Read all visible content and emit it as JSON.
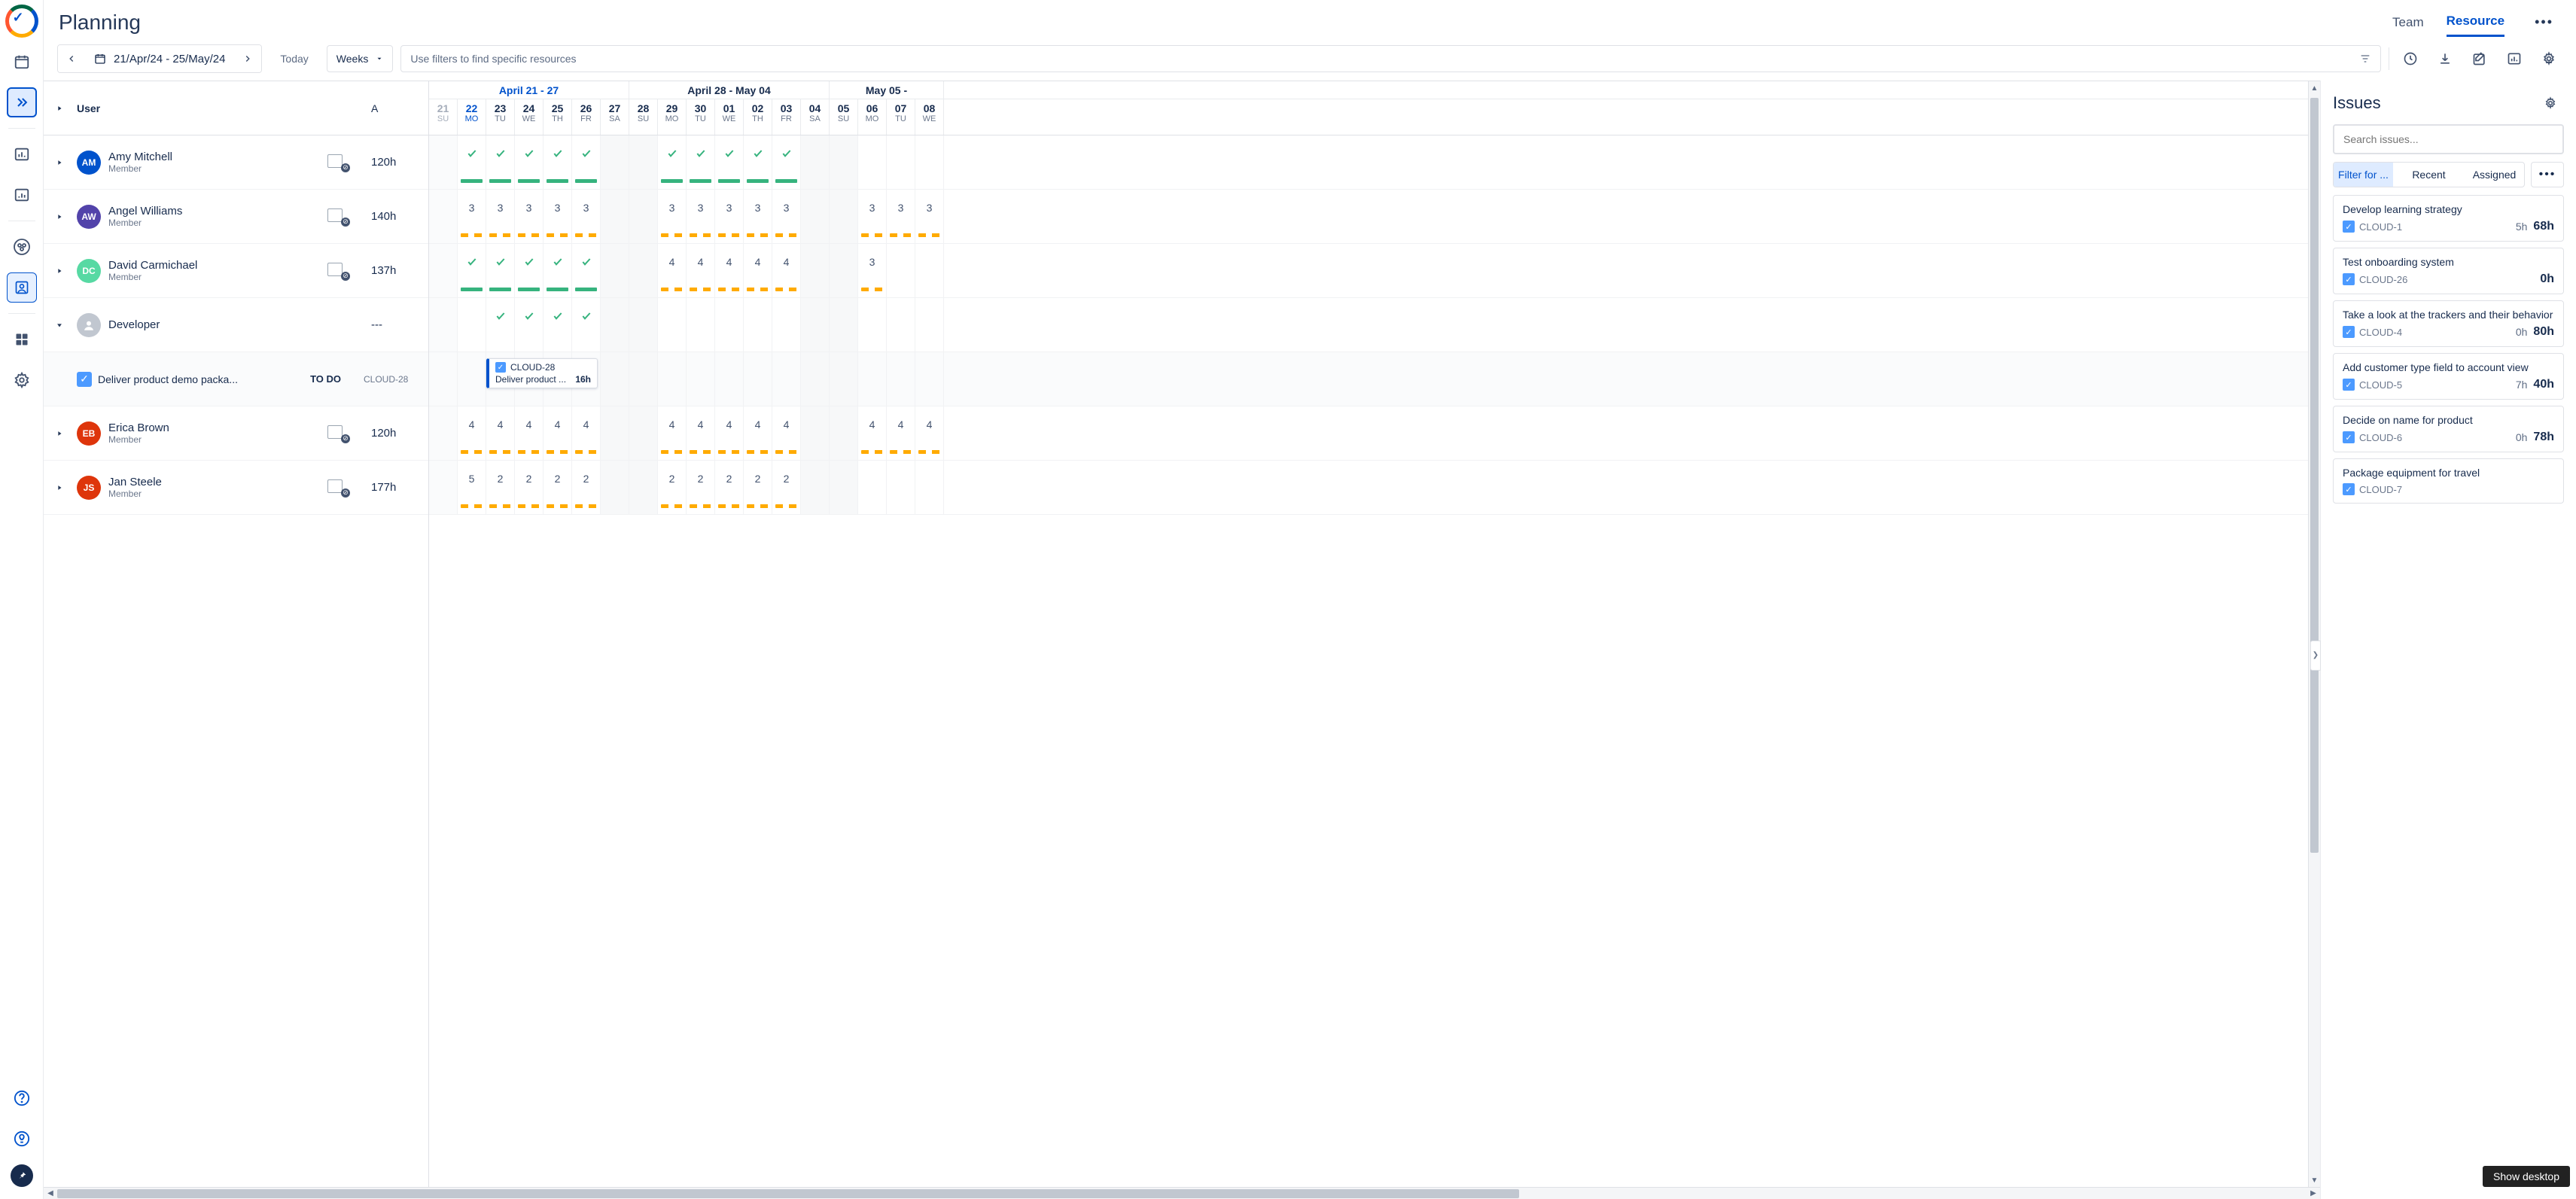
{
  "header": {
    "title": "Planning",
    "tabs": [
      "Team",
      "Resource"
    ],
    "active_tab": "Resource"
  },
  "toolbar": {
    "date_range": "21/Apr/24 - 25/May/24",
    "today": "Today",
    "granularity": "Weeks",
    "filter_placeholder": "Use filters to find specific resources"
  },
  "timeline": {
    "weeks": [
      {
        "label": "April 21 - 27",
        "span": 7
      },
      {
        "label": "April 28 - May 04",
        "span": 7
      },
      {
        "label": "May 05 -",
        "span": 4
      }
    ],
    "days": [
      {
        "d": "21",
        "dow": "SU",
        "dim": true,
        "wkend": true
      },
      {
        "d": "22",
        "dow": "MO",
        "today": true
      },
      {
        "d": "23",
        "dow": "TU"
      },
      {
        "d": "24",
        "dow": "WE"
      },
      {
        "d": "25",
        "dow": "TH"
      },
      {
        "d": "26",
        "dow": "FR"
      },
      {
        "d": "27",
        "dow": "SA",
        "wkend": true
      },
      {
        "d": "28",
        "dow": "SU",
        "wkend": true
      },
      {
        "d": "29",
        "dow": "MO"
      },
      {
        "d": "30",
        "dow": "TU"
      },
      {
        "d": "01",
        "dow": "WE"
      },
      {
        "d": "02",
        "dow": "TH"
      },
      {
        "d": "03",
        "dow": "FR"
      },
      {
        "d": "04",
        "dow": "SA",
        "wkend": true
      },
      {
        "d": "05",
        "dow": "SU",
        "wkend": true
      },
      {
        "d": "06",
        "dow": "MO"
      },
      {
        "d": "07",
        "dow": "TU"
      },
      {
        "d": "08",
        "dow": "WE"
      }
    ]
  },
  "left": {
    "user_col": "User",
    "a_col": "A"
  },
  "rows": [
    {
      "type": "user",
      "initials": "AM",
      "color": "#0052cc",
      "name": "Amy Mitchell",
      "role": "Member",
      "hours": "120h",
      "cells": [
        {
          "blank": true
        },
        {
          "chk": true,
          "bar": "green"
        },
        {
          "chk": true,
          "bar": "green"
        },
        {
          "chk": true,
          "bar": "green"
        },
        {
          "chk": true,
          "bar": "green"
        },
        {
          "chk": true,
          "bar": "green"
        },
        {
          "blank": true
        },
        {
          "blank": true
        },
        {
          "chk": true,
          "bar": "green"
        },
        {
          "chk": true,
          "bar": "green"
        },
        {
          "chk": true,
          "bar": "green"
        },
        {
          "chk": true,
          "bar": "green"
        },
        {
          "chk": true,
          "bar": "green"
        },
        {
          "blank": true
        },
        {
          "blank": true
        },
        {
          "blank": true
        },
        {
          "blank": true
        },
        {
          "blank": true
        }
      ]
    },
    {
      "type": "user",
      "initials": "AW",
      "color": "#5243aa",
      "name": "Angel Williams",
      "role": "Member",
      "hours": "140h",
      "cells": [
        {
          "blank": true
        },
        {
          "num": "3",
          "bar": "yellow"
        },
        {
          "num": "3",
          "bar": "yellow"
        },
        {
          "num": "3",
          "bar": "yellow"
        },
        {
          "num": "3",
          "bar": "yellow"
        },
        {
          "num": "3",
          "bar": "yellow"
        },
        {
          "blank": true
        },
        {
          "blank": true
        },
        {
          "num": "3",
          "bar": "yellow"
        },
        {
          "num": "3",
          "bar": "yellow"
        },
        {
          "num": "3",
          "bar": "yellow"
        },
        {
          "num": "3",
          "bar": "yellow"
        },
        {
          "num": "3",
          "bar": "yellow"
        },
        {
          "blank": true
        },
        {
          "blank": true
        },
        {
          "num": "3",
          "bar": "yellow"
        },
        {
          "num": "3",
          "bar": "yellow"
        },
        {
          "num": "3",
          "bar": "yellow"
        }
      ]
    },
    {
      "type": "user",
      "initials": "DC",
      "color": "#57d9a3",
      "name": "David Carmichael",
      "role": "Member",
      "hours": "137h",
      "cells": [
        {
          "blank": true
        },
        {
          "chk": true,
          "bar": "green"
        },
        {
          "chk": true,
          "bar": "green"
        },
        {
          "chk": true,
          "bar": "green"
        },
        {
          "chk": true,
          "bar": "green"
        },
        {
          "chk": true,
          "bar": "green"
        },
        {
          "blank": true
        },
        {
          "blank": true
        },
        {
          "num": "4",
          "bar": "yellow"
        },
        {
          "num": "4",
          "bar": "yellow"
        },
        {
          "num": "4",
          "bar": "yellow"
        },
        {
          "num": "4",
          "bar": "yellow"
        },
        {
          "num": "4",
          "bar": "yellow"
        },
        {
          "blank": true
        },
        {
          "blank": true
        },
        {
          "num": "3",
          "bar": "yellow"
        },
        {
          "blank": true
        },
        {
          "blank": true
        }
      ]
    },
    {
      "type": "group",
      "name": "Developer",
      "hours": "---",
      "expanded": true,
      "cells": [
        {
          "blank": true
        },
        {
          "blank": true
        },
        {
          "chk": true
        },
        {
          "chk": true
        },
        {
          "chk": true
        },
        {
          "chk": true
        },
        {
          "blank": true
        },
        {
          "blank": true
        },
        {
          "blank": true
        },
        {
          "blank": true
        },
        {
          "blank": true
        },
        {
          "blank": true
        },
        {
          "blank": true
        },
        {
          "blank": true
        },
        {
          "blank": true
        },
        {
          "blank": true
        },
        {
          "blank": true
        },
        {
          "blank": true
        }
      ]
    },
    {
      "type": "task",
      "name": "Deliver product demo packa...",
      "status": "TO DO",
      "key": "CLOUD-28",
      "card": {
        "key": "CLOUD-28",
        "title": "Deliver product ...",
        "hours": "16h"
      }
    },
    {
      "type": "user",
      "initials": "EB",
      "color": "#de350b",
      "name": "Erica Brown",
      "role": "Member",
      "hours": "120h",
      "cells": [
        {
          "blank": true
        },
        {
          "num": "4",
          "bar": "yellow"
        },
        {
          "num": "4",
          "bar": "yellow"
        },
        {
          "num": "4",
          "bar": "yellow"
        },
        {
          "num": "4",
          "bar": "yellow"
        },
        {
          "num": "4",
          "bar": "yellow"
        },
        {
          "blank": true
        },
        {
          "blank": true
        },
        {
          "num": "4",
          "bar": "yellow"
        },
        {
          "num": "4",
          "bar": "yellow"
        },
        {
          "num": "4",
          "bar": "yellow"
        },
        {
          "num": "4",
          "bar": "yellow"
        },
        {
          "num": "4",
          "bar": "yellow"
        },
        {
          "blank": true
        },
        {
          "blank": true
        },
        {
          "num": "4",
          "bar": "yellow"
        },
        {
          "num": "4",
          "bar": "yellow"
        },
        {
          "num": "4",
          "bar": "yellow"
        }
      ]
    },
    {
      "type": "user",
      "initials": "JS",
      "color": "#de350b",
      "name": "Jan Steele",
      "role": "Member",
      "hours": "177h",
      "cells": [
        {
          "blank": true
        },
        {
          "num": "5",
          "bar": "yellow"
        },
        {
          "num": "2",
          "bar": "yellow"
        },
        {
          "num": "2",
          "bar": "yellow"
        },
        {
          "num": "2",
          "bar": "yellow"
        },
        {
          "num": "2",
          "bar": "yellow"
        },
        {
          "blank": true
        },
        {
          "blank": true
        },
        {
          "num": "2",
          "bar": "yellow"
        },
        {
          "num": "2",
          "bar": "yellow"
        },
        {
          "num": "2",
          "bar": "yellow"
        },
        {
          "num": "2",
          "bar": "yellow"
        },
        {
          "num": "2",
          "bar": "yellow"
        },
        {
          "blank": true
        },
        {
          "blank": true
        },
        {
          "blank": true
        },
        {
          "blank": true
        },
        {
          "blank": true
        }
      ]
    }
  ],
  "panel": {
    "title": "Issues",
    "search_placeholder": "Search issues...",
    "filters": [
      "Filter for ...",
      "Recent",
      "Assigned"
    ],
    "issues": [
      {
        "title": "Develop learning strategy",
        "key": "CLOUD-1",
        "hours": "5h",
        "total": "68h"
      },
      {
        "title": "Test onboarding system",
        "key": "CLOUD-26",
        "hours": "",
        "total": "0h"
      },
      {
        "title": "Take a look at the trackers and their behavior",
        "key": "CLOUD-4",
        "hours": "0h",
        "total": "80h"
      },
      {
        "title": "Add customer type field to account view",
        "key": "CLOUD-5",
        "hours": "7h",
        "total": "40h"
      },
      {
        "title": "Decide on name for product",
        "key": "CLOUD-6",
        "hours": "0h",
        "total": "78h"
      },
      {
        "title": "Package equipment for travel",
        "key": "CLOUD-7",
        "hours": "",
        "total": ""
      }
    ]
  },
  "desktop_badge": "Show desktop"
}
